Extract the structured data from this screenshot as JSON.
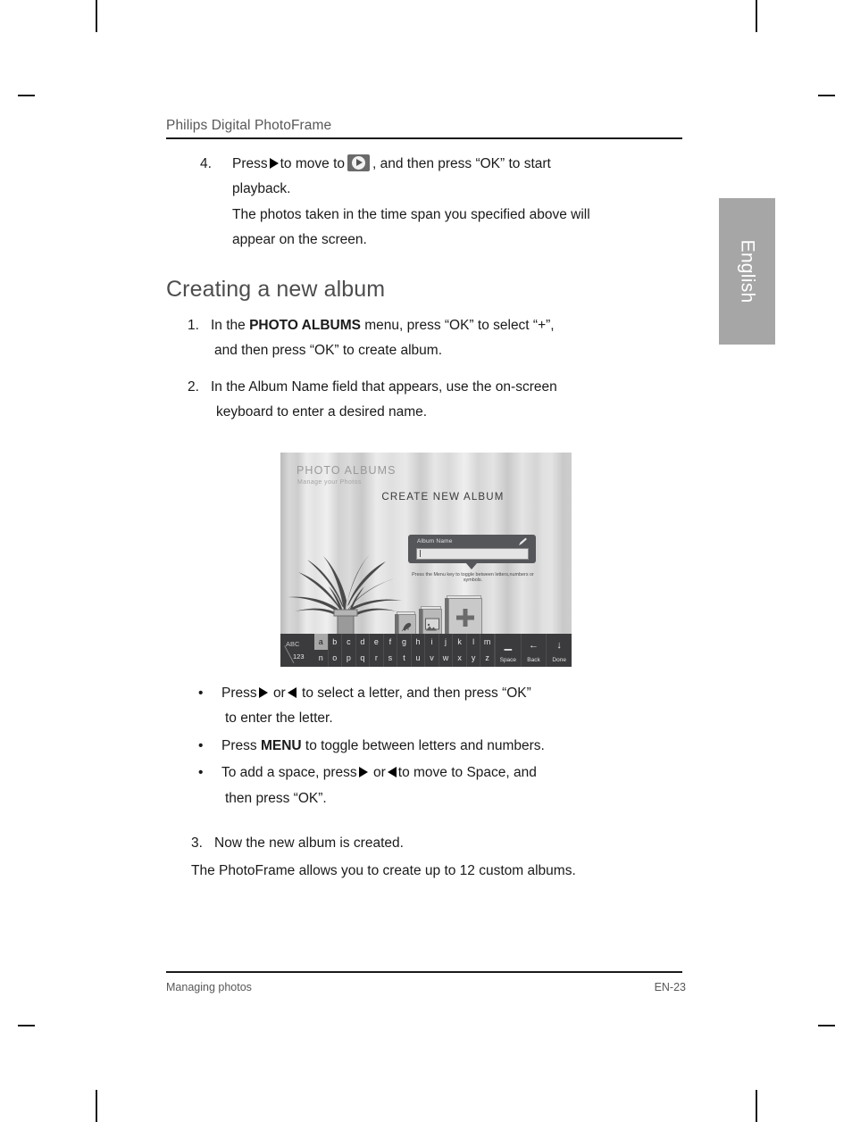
{
  "header": {
    "title": "Philips Digital PhotoFrame"
  },
  "language_tab": {
    "label": "English"
  },
  "step4": {
    "number": "4.",
    "text_before_tri": "Press",
    "text_after_tri": "to move to",
    "text_after_chip": ", and then press “OK”  to start",
    "line2": "playback.",
    "line3": "The photos taken in the time span you specified above will",
    "line4": "appear on the screen."
  },
  "section": {
    "heading": "Creating a new album",
    "items": [
      {
        "number": "1.",
        "line1_a": "In the ",
        "line1_bold": "PHOTO ALBUMS",
        "line1_b": " menu, press “OK” to select “+”,",
        "line2": "and then press “OK” to create album."
      },
      {
        "number": "2.",
        "line1": "In the Album Name field that appears, use the on-screen",
        "line2": "keyboard to enter a desired name."
      }
    ]
  },
  "bullets": [
    {
      "dot": "•",
      "a": "Press",
      "b": "or",
      "c": "to select a letter, and then press “OK”",
      "line2": "to enter the letter."
    },
    {
      "dot": "•",
      "a": "Press ",
      "bold": "MENU",
      "b": " to toggle between letters and numbers."
    },
    {
      "dot": "•",
      "a": "To add a space, press",
      "b": "or",
      "c": "to move to Space, and",
      "line2": "then press “OK”."
    }
  ],
  "closing": {
    "number": "3.",
    "line1": "Now the new album is created.",
    "line2": "The PhotoFrame allows you to create up to 12 custom albums."
  },
  "photoframe_screenshot": {
    "menu_title": "PHOTO ALBUMS",
    "menu_subtitle": "Manage your Photos",
    "screen_title": "CREATE NEW ALBUM",
    "field_label": "Album Name",
    "field_value": "",
    "hint": "Press the Menu key to toggle between letters,numbers or symbols.",
    "keyboard": {
      "toggle_upper": "ABC",
      "toggle_lower": "123",
      "row1": [
        "a",
        "b",
        "c",
        "d",
        "e",
        "f",
        "g",
        "h",
        "i",
        "j",
        "k",
        "l",
        "m"
      ],
      "row2": [
        "n",
        "o",
        "p",
        "q",
        "r",
        "s",
        "t",
        "u",
        "v",
        "w",
        "x",
        "y",
        "z"
      ],
      "selected_key": "a",
      "functions": [
        {
          "glyph": "▁",
          "label": "Space"
        },
        {
          "glyph": "←",
          "label": "Back"
        },
        {
          "glyph": "↓",
          "label": "Done"
        }
      ]
    }
  },
  "footer": {
    "left": "Managing photos",
    "right": "EN-23"
  }
}
